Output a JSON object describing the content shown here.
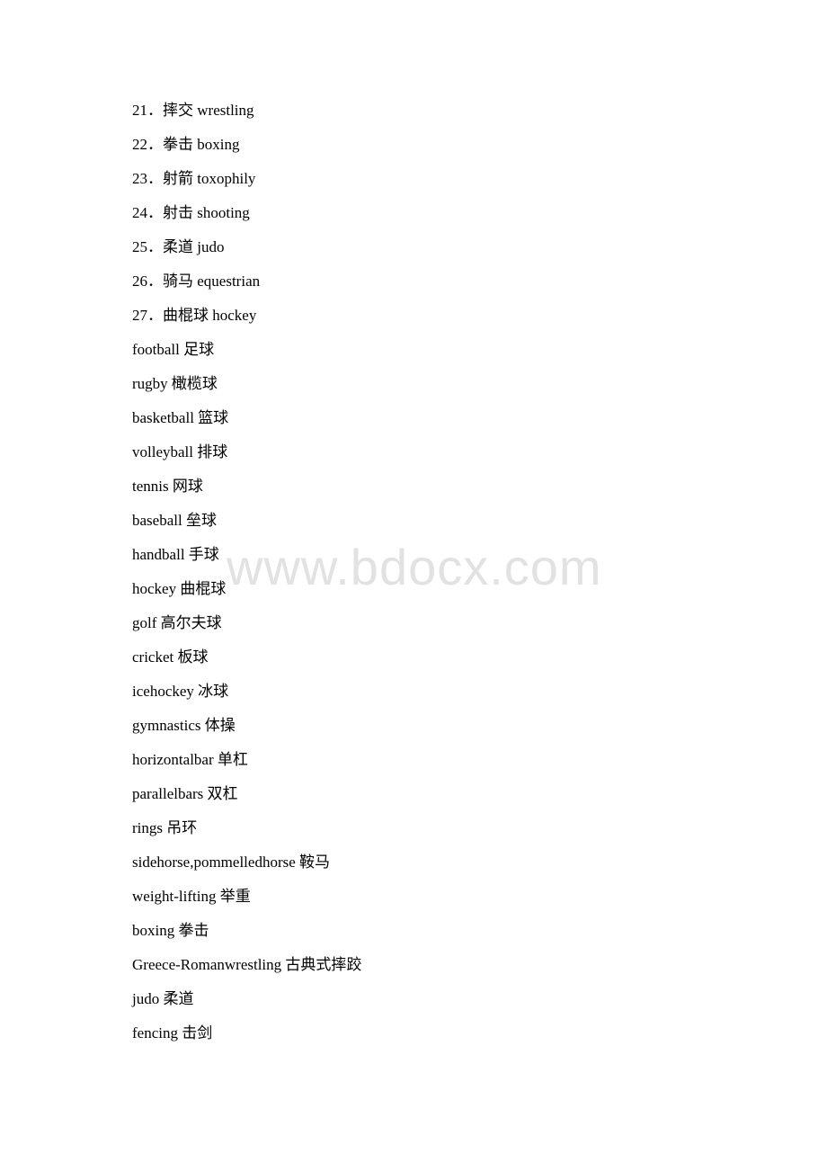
{
  "numbered_items": [
    {
      "num": "21．",
      "text": "摔交 wrestling"
    },
    {
      "num": "22．",
      "text": "拳击 boxing"
    },
    {
      "num": "23．",
      "text": "射箭 toxophily"
    },
    {
      "num": "24．",
      "text": "射击 shooting"
    },
    {
      "num": "25．",
      "text": "柔道 judo"
    },
    {
      "num": "26．",
      "text": "骑马 equestrian"
    },
    {
      "num": "27．",
      "text": "曲棍球 hockey"
    }
  ],
  "vocab_items": [
    "football 足球",
    "rugby 橄榄球",
    "basketball 篮球",
    "volleyball 排球",
    "tennis 网球",
    "baseball 垒球",
    "handball 手球",
    "hockey 曲棍球",
    "golf 高尔夫球",
    "cricket 板球",
    "icehockey 冰球",
    "gymnastics 体操",
    "horizontalbar 单杠",
    "parallelbars 双杠",
    "rings 吊环",
    "sidehorse,pommelledhorse 鞍马",
    "weight-lifting 举重",
    "boxing 拳击",
    "Greece-Romanwrestling 古典式摔跤",
    "judo 柔道",
    "fencing 击剑"
  ],
  "watermark": "www.bdocx.com"
}
